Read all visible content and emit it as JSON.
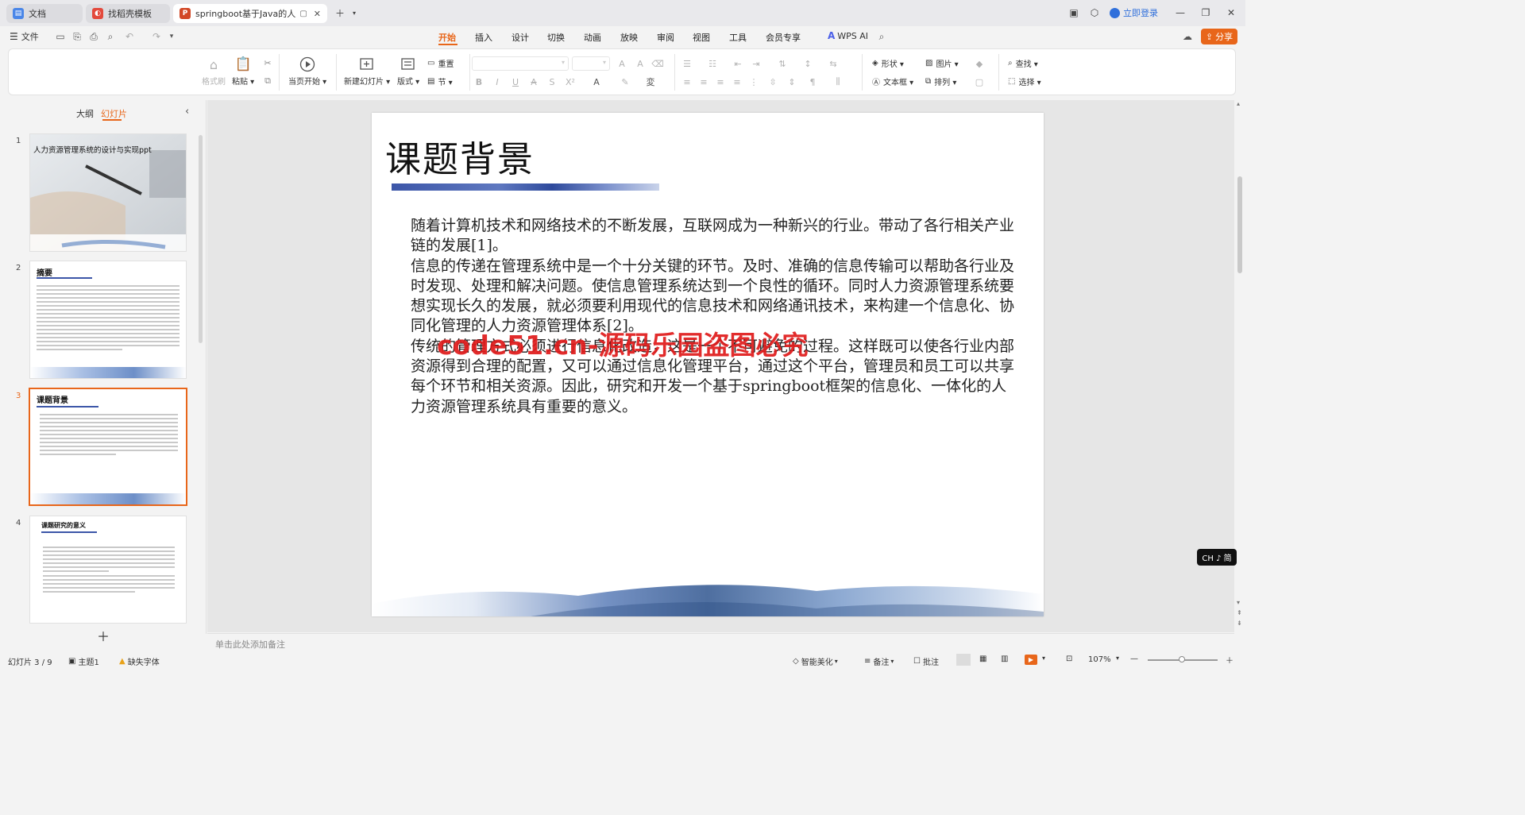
{
  "tabs": [
    {
      "label": "文档",
      "icon": "doc-icon",
      "color": "#4a86e8"
    },
    {
      "label": "找稻壳模板",
      "icon": "daoke-icon",
      "color": "#e3493c"
    },
    {
      "label": "springboot基于Java的人力",
      "icon": "ppt-icon",
      "color": "#d24726"
    }
  ],
  "titlebar": {
    "login": "立即登录"
  },
  "menu": {
    "file": "文件",
    "tabs": [
      "开始",
      "插入",
      "设计",
      "切换",
      "动画",
      "放映",
      "审阅",
      "视图",
      "工具",
      "会员专享"
    ],
    "active": "开始",
    "wps_ai": "WPS AI",
    "share": "分享"
  },
  "ribbon": {
    "format_painter": "格式刷",
    "paste": "粘贴",
    "play_from_current": "当页开始",
    "new_slide": "新建幻灯片",
    "layout": "版式",
    "reset": "重置",
    "section": "节",
    "shape": "形状",
    "picture": "图片",
    "textbox": "文本框",
    "arrange": "排列",
    "find": "查找",
    "select": "选择"
  },
  "panel": {
    "tab_outline": "大纲",
    "tab_slides": "幻灯片",
    "active_tab": "幻灯片"
  },
  "thumbnails": [
    {
      "num": "1",
      "title": "人力资源管理系统的设计与实现ppt"
    },
    {
      "num": "2",
      "title": "摘要"
    },
    {
      "num": "3",
      "title": "课题背景"
    },
    {
      "num": "4",
      "title": "课题研究的意义"
    }
  ],
  "slide": {
    "title": "课题背景",
    "paragraphs": [
      "随着计算机技术和网络技术的不断发展，互联网成为一种新兴的行业。带动了各行相关产业链的发展[1]。",
      "信息的传递在管理系统中是一个十分关键的环节。及时、准确的信息传输可以帮助各行业及时发现、处理和解决问题。使信息管理系统达到一个良性的循环。同时人力资源管理系统要想实现长久的发展，就必须要利用现代的信息技术和网络通讯技术，来构建一个信息化、协同化管理的人力资源管理体系[2]。",
      "传统的管理方式必须进行信息化改造，这是一个不可避免的过程。这样既可以使各行业内部资源得到合理的配置，又可以通过信息化管理平台，通过这个平台，管理员和员工可以共享每个环节和相关资源。因此，研究和开发一个基于springboot框架的信息化、一体化的人力资源管理系统具有重要的意义。"
    ],
    "watermark": "code51.cn-源码乐园盗图必究"
  },
  "notes_placeholder": "单击此处添加备注",
  "ime": "CH ♪ 简",
  "status": {
    "slide_counter": "幻灯片 3 / 9",
    "theme": "主题1",
    "missing_font": "缺失字体",
    "smart_beautify": "智能美化",
    "notes": "备注",
    "comments": "批注",
    "zoom": "107%"
  },
  "colors": {
    "accent": "#e8661a",
    "watermark": "#e01b1b"
  }
}
